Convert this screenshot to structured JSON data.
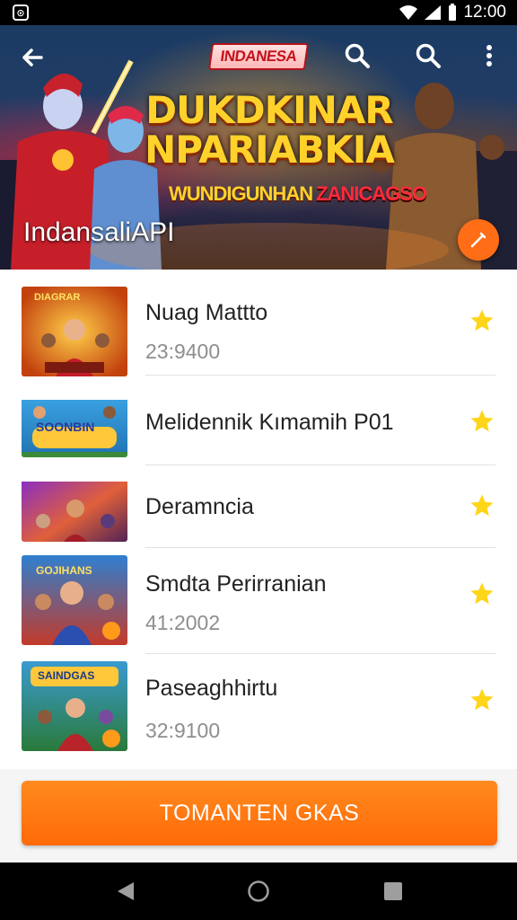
{
  "status_bar": {
    "time": "12:00",
    "notification_icon": "notification-icon"
  },
  "toolbar": {
    "logo": "INDANESA",
    "back_icon": "back-arrow-icon",
    "search_icon": "search-icon",
    "more_icon": "more-vert-icon"
  },
  "hero": {
    "title_line_1": "DUKDKINAR",
    "title_line_2": "NPARIABKIA",
    "subtitle_left": "WUNDIGUNHAN",
    "subtitle_right": "ZANICAGSO",
    "channel_name": "IndansaliAPI",
    "edit_icon": "edit-icon"
  },
  "items": [
    {
      "title": "Nuag Mattto",
      "count": "23:9400"
    },
    {
      "title": "Melidennik Kımamih P01",
      "count": ""
    },
    {
      "title": "Deramncia",
      "count": ""
    },
    {
      "title": "Smdta Perirranian",
      "count": "41:2002"
    },
    {
      "title": "Paseaghhirtu",
      "count": "32:9100"
    }
  ],
  "thumbnails": [
    {
      "label": "DIAGRAR"
    },
    {
      "label": "SOONBIN"
    },
    {
      "label": ""
    },
    {
      "label": "GOJIHANS"
    },
    {
      "label": "SAINDGAS"
    }
  ],
  "cta": {
    "label": "TOMANTEN GKAS"
  },
  "colors": {
    "accent": "#ff6d17",
    "star": "#ffd51a",
    "cta": "#ff7a12"
  }
}
